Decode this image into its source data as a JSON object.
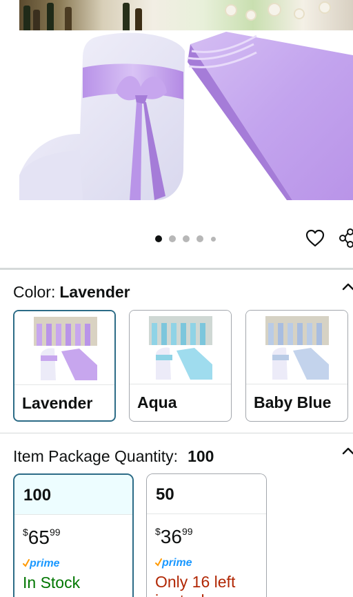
{
  "gallery": {
    "dot_count": 5,
    "active_index": 0,
    "colors": {
      "satin": "#c7a6ee",
      "satin_dark": "#a57cd8",
      "chair": "#ecebf8"
    }
  },
  "actions": {
    "favorite_icon": "heart-icon",
    "share_icon": "share-icon"
  },
  "color_section": {
    "label": "Color:",
    "selected": "Lavender",
    "swatches": [
      {
        "name": "Lavender",
        "selected": true,
        "accent": "#c7a6ee"
      },
      {
        "name": "Aqua",
        "selected": false,
        "accent": "#8fd3e6"
      },
      {
        "name": "Baby Blue",
        "selected": false,
        "accent": "#b9cbe6"
      }
    ]
  },
  "quantity_section": {
    "label": "Item Package Quantity:",
    "selected": "100",
    "options": [
      {
        "qty": "100",
        "currency": "$",
        "price_whole": "65",
        "price_fraction": "99",
        "prime": "prime",
        "stock": "In Stock",
        "stock_color": "#007600",
        "selected": true
      },
      {
        "qty": "50",
        "currency": "$",
        "price_whole": "36",
        "price_fraction": "99",
        "prime": "prime",
        "stock": "Only 16 left",
        "stock_more": "in stock",
        "stock_color": "#b12704",
        "selected": false
      }
    ]
  },
  "colors": {
    "selected_border": "#2b6b86",
    "divider": "#d5d9d9",
    "prime_blue": "#1a98ff",
    "prime_check": "#ff9900"
  }
}
